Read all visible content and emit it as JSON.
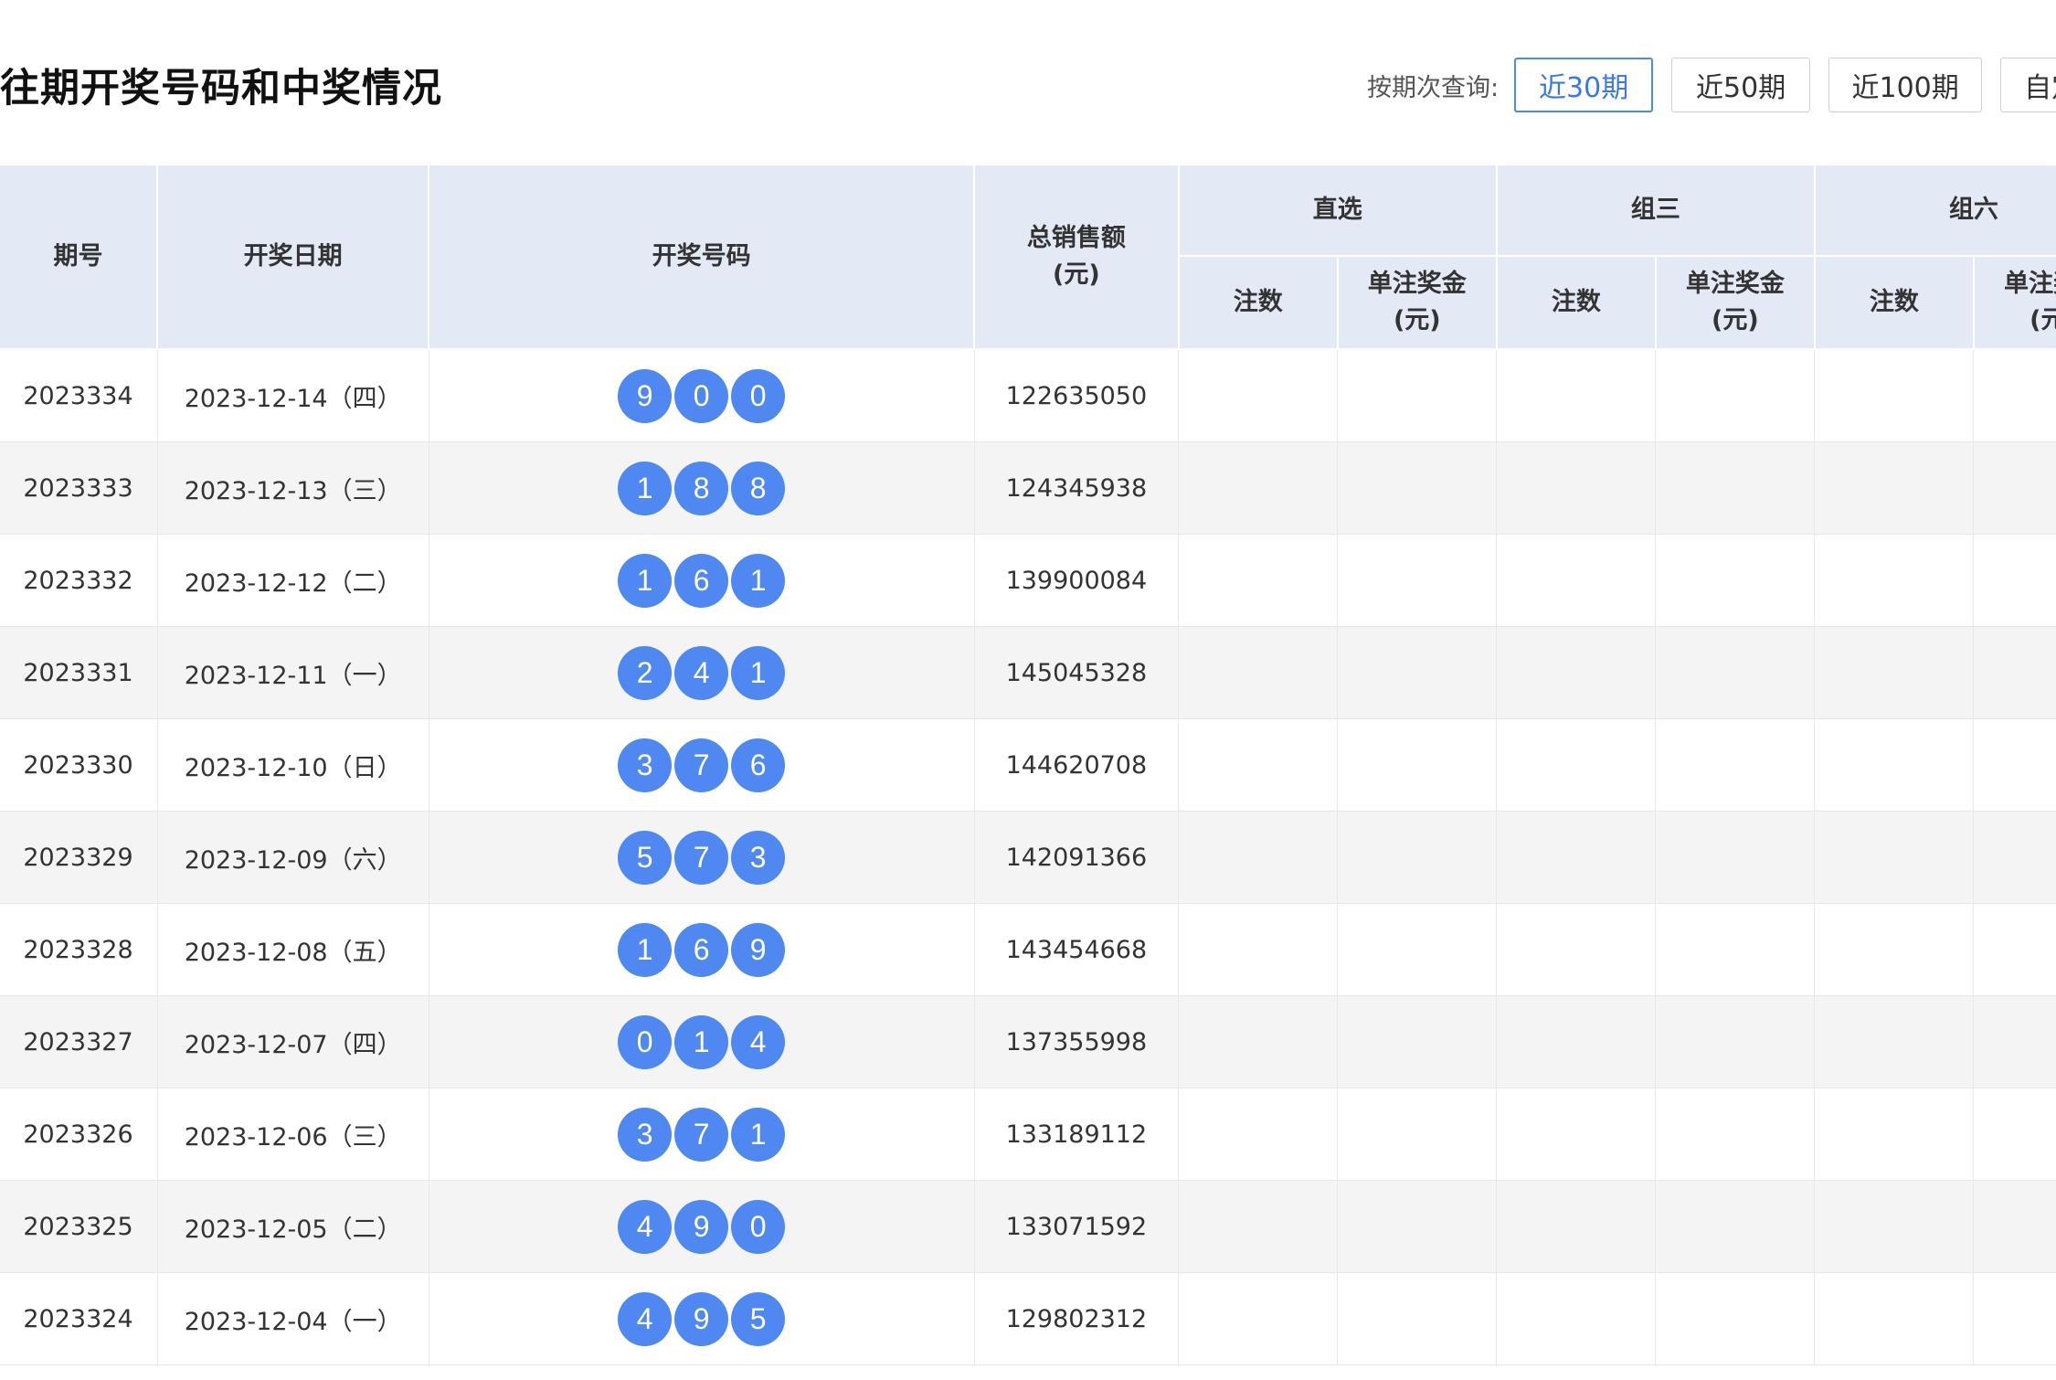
{
  "header": {
    "title": "往期开奖号码和中奖情况",
    "query_label": "按期次查询:",
    "buttons": [
      {
        "label": "近30期",
        "active": true
      },
      {
        "label": "近50期",
        "active": false
      },
      {
        "label": "近100期",
        "active": false
      },
      {
        "label": "自定义",
        "active": false
      }
    ]
  },
  "table": {
    "headers": {
      "issue": "期号",
      "date": "开奖日期",
      "numbers": "开奖号码",
      "sales": "总销售额",
      "sales_unit": "(元)",
      "direct": "直选",
      "group3": "组三",
      "group6": "组六",
      "count": "注数",
      "prize": "单注奖金",
      "prize_unit": "(元)"
    },
    "rows": [
      {
        "issue": "2023334",
        "date": "2023-12-14（四）",
        "balls": [
          "9",
          "0",
          "0"
        ],
        "sales": "122635050"
      },
      {
        "issue": "2023333",
        "date": "2023-12-13（三）",
        "balls": [
          "1",
          "8",
          "8"
        ],
        "sales": "124345938"
      },
      {
        "issue": "2023332",
        "date": "2023-12-12（二）",
        "balls": [
          "1",
          "6",
          "1"
        ],
        "sales": "139900084"
      },
      {
        "issue": "2023331",
        "date": "2023-12-11（一）",
        "balls": [
          "2",
          "4",
          "1"
        ],
        "sales": "145045328"
      },
      {
        "issue": "2023330",
        "date": "2023-12-10（日）",
        "balls": [
          "3",
          "7",
          "6"
        ],
        "sales": "144620708"
      },
      {
        "issue": "2023329",
        "date": "2023-12-09（六）",
        "balls": [
          "5",
          "7",
          "3"
        ],
        "sales": "142091366"
      },
      {
        "issue": "2023328",
        "date": "2023-12-08（五）",
        "balls": [
          "1",
          "6",
          "9"
        ],
        "sales": "143454668"
      },
      {
        "issue": "2023327",
        "date": "2023-12-07（四）",
        "balls": [
          "0",
          "1",
          "4"
        ],
        "sales": "137355998"
      },
      {
        "issue": "2023326",
        "date": "2023-12-06（三）",
        "balls": [
          "3",
          "7",
          "1"
        ],
        "sales": "133189112"
      },
      {
        "issue": "2023325",
        "date": "2023-12-05（二）",
        "balls": [
          "4",
          "9",
          "0"
        ],
        "sales": "133071592"
      },
      {
        "issue": "2023324",
        "date": "2023-12-04（一）",
        "balls": [
          "4",
          "9",
          "5"
        ],
        "sales": "129802312"
      }
    ]
  },
  "colors": {
    "ball": "#4f88f0",
    "header_bg": "#e4e9f6",
    "active_button": "#3b78e7",
    "zebra_row": "#f4f4f4"
  }
}
